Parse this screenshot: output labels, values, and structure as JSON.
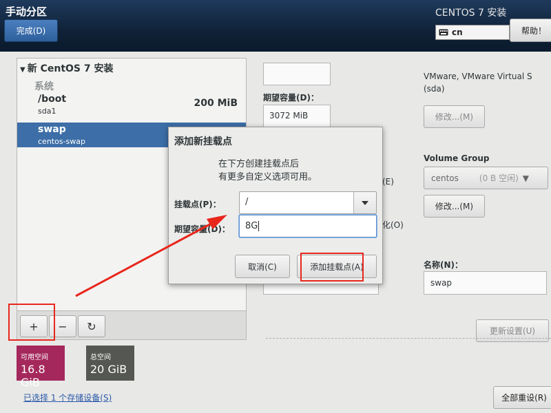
{
  "header": {
    "title": "手动分区",
    "done_label": "完成(D)",
    "product": "CENTOS 7 安装",
    "keyboard": "cn",
    "help_label": "帮助！"
  },
  "left": {
    "install_title": "新 CentOS 7 安装",
    "system_label": "系统",
    "mountpoints": [
      {
        "name": "/boot",
        "device": "sda1",
        "size": "200 MiB",
        "selected": false
      },
      {
        "name": "swap",
        "device": "centos-swap",
        "size": "",
        "selected": true
      }
    ],
    "toolbar": {
      "add": "+",
      "remove": "−",
      "refresh": "↻"
    }
  },
  "space": {
    "available_label": "可用空间",
    "available_value": "16.8 GiB",
    "total_label": "总空间",
    "total_value": "20 GiB",
    "available_color": "#a4285c",
    "total_color": "#555753"
  },
  "storage_link": "已选择 1 个存储设备(S)",
  "right": {
    "desired_capacity_label": "期望容量(D)：",
    "desired_capacity_value": "3072 MiB",
    "device_text_1": "VMware, VMware Virtual S",
    "device_text_2": "(sda)",
    "modify_label": "修改...(M)",
    "partial_e": "(E)",
    "partial_o": "化(O)",
    "volume_group_label": "Volume Group",
    "volume_group_name": "centos",
    "volume_group_free": "(0 B 空闲)",
    "modify2_label": "修改...(M)",
    "name_label": "名称(N)：",
    "name_value": "swap",
    "update_label": "更新设置(U)",
    "reset_all_label": "全部重设(R)"
  },
  "dialog": {
    "title": "添加新挂载点",
    "subtitle_1": "在下方创建挂载点后",
    "subtitle_2": "有更多自定义选项可用。",
    "mount_label": "挂载点(P)：",
    "mount_value": "/",
    "capacity_label": "期望容量(D)：",
    "capacity_value": "8G",
    "cancel_label": "取消(C)",
    "add_label": "添加挂载点(A)"
  },
  "colors": {
    "highlight": "#e8261b",
    "selection": "#3d6ea7"
  }
}
